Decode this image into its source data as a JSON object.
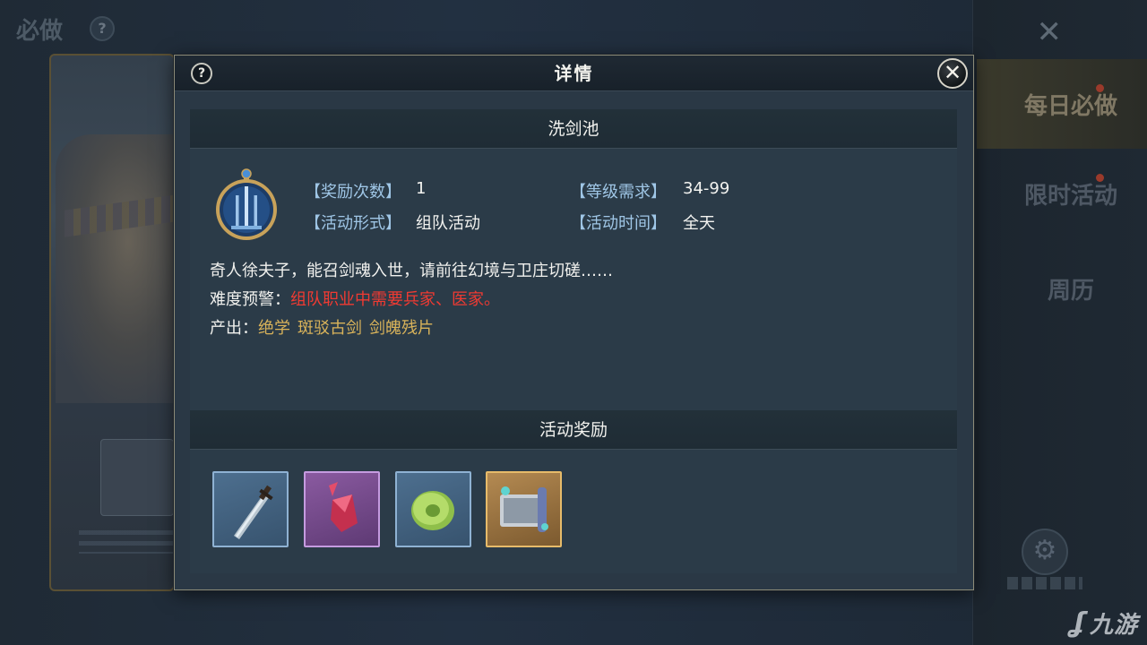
{
  "background": {
    "title": "必做",
    "help_icon": "question-icon",
    "close_icon": "close-icon",
    "tabs": [
      {
        "label": "每日必做",
        "active": true,
        "dot": true
      },
      {
        "label": "限时活动",
        "active": false,
        "dot": true
      },
      {
        "label": "周历",
        "active": false,
        "dot": false
      }
    ]
  },
  "dialog": {
    "title": "详情",
    "help_label": "?",
    "close_label": "✕",
    "activity_name": "洗剑池",
    "info": {
      "reward_times_label": "【奖励次数】",
      "reward_times_value": "1",
      "level_req_label": "【等级需求】",
      "level_req_value": "34-99",
      "form_label": "【活动形式】",
      "form_value": "组队活动",
      "time_label": "【活动时间】",
      "time_value": "全天"
    },
    "description": "奇人徐夫子，能召剑魂入世，请前往幻境与卫庄切磋……",
    "warning_label": "难度预警：",
    "warning_text": "组队职业中需要兵家、医家。",
    "output_label": "产出：",
    "outputs": [
      "绝学",
      "斑驳古剑",
      "剑魄残片"
    ],
    "rewards_title": "活动奖励",
    "rewards": [
      {
        "icon": "sword-icon",
        "rarity": "blue"
      },
      {
        "icon": "crystal-shard-icon",
        "rarity": "purple"
      },
      {
        "icon": "jade-disc-icon",
        "rarity": "blue"
      },
      {
        "icon": "scroll-icon",
        "rarity": "gold"
      }
    ]
  },
  "colors": {
    "label_blue": "#9fc6e6",
    "warning_red": "#f03a32",
    "output_gold": "#d9b35a"
  }
}
